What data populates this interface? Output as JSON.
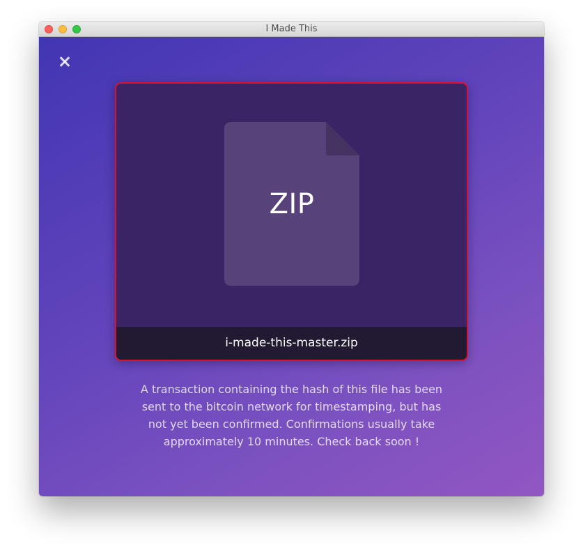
{
  "window": {
    "title": "I Made This"
  },
  "controls": {
    "close_icon": "close-x-icon"
  },
  "file": {
    "icon": "zip-file-icon",
    "type_label": "ZIP",
    "name": "i-made-this-master.zip",
    "highlight_color": "#e0102a"
  },
  "status": {
    "message": "A transaction containing the hash of this file has been sent to the bitcoin network for timestamping, but has not yet been confirmed. Confirmations usually take approximately 10 minutes. Check back soon !"
  },
  "colors": {
    "background_start": "#4236b2",
    "background_end": "#9256c2",
    "card_background": "#3b2465",
    "filename_bar": "#221a33"
  }
}
